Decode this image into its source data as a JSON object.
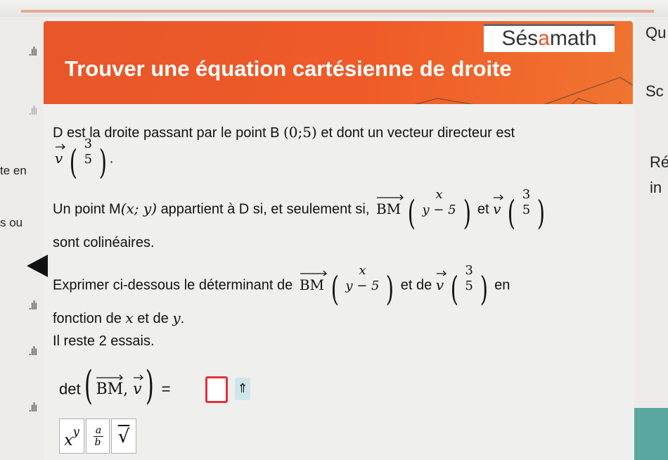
{
  "header": {
    "brand_prefix": "Sés",
    "brand_accent": "a",
    "brand_suffix": "math",
    "title": "Trouver une équation cartésienne de droite"
  },
  "right_panel": {
    "heading_1": "Qu",
    "heading_2": "Sc",
    "heading_3": "Ré",
    "heading_4": "in"
  },
  "left_panel": {
    "text_1": "te en",
    "text_2": "s ou"
  },
  "statement": {
    "line1": "D est la droite passant par le point B",
    "point_B": "(0;5)",
    "line1_end": "et dont un vecteur directeur est",
    "v_x": "3",
    "v_y": "5",
    "line2_start": "Un point M",
    "M_coords": "(x; y)",
    "line2_mid": "appartient à D si, et seulement si,",
    "BM_label": "BM",
    "BM_x": "x",
    "BM_y": "y − 5",
    "et": "et",
    "v_label": "v",
    "line3": "sont colinéaires."
  },
  "question": {
    "text_start": "Exprimer ci-dessous le déterminant de",
    "text_mid": "et de",
    "text_end": "en",
    "line2_pre": "fonction de",
    "var_x": "x",
    "line2_mid": "et de",
    "var_y": "y",
    "attempts": "Il reste 2 essais."
  },
  "answer": {
    "det_label": "det",
    "equals": "=",
    "up_button": "⇑"
  },
  "keyboard": {
    "power_base": "x",
    "power_exp": "y",
    "frac_num": "a",
    "frac_den": "b",
    "sqrt": "√"
  },
  "colors": {
    "banner": "#ef5b28",
    "input_border": "#e2313d",
    "accent_teal": "#5aa7a0"
  }
}
